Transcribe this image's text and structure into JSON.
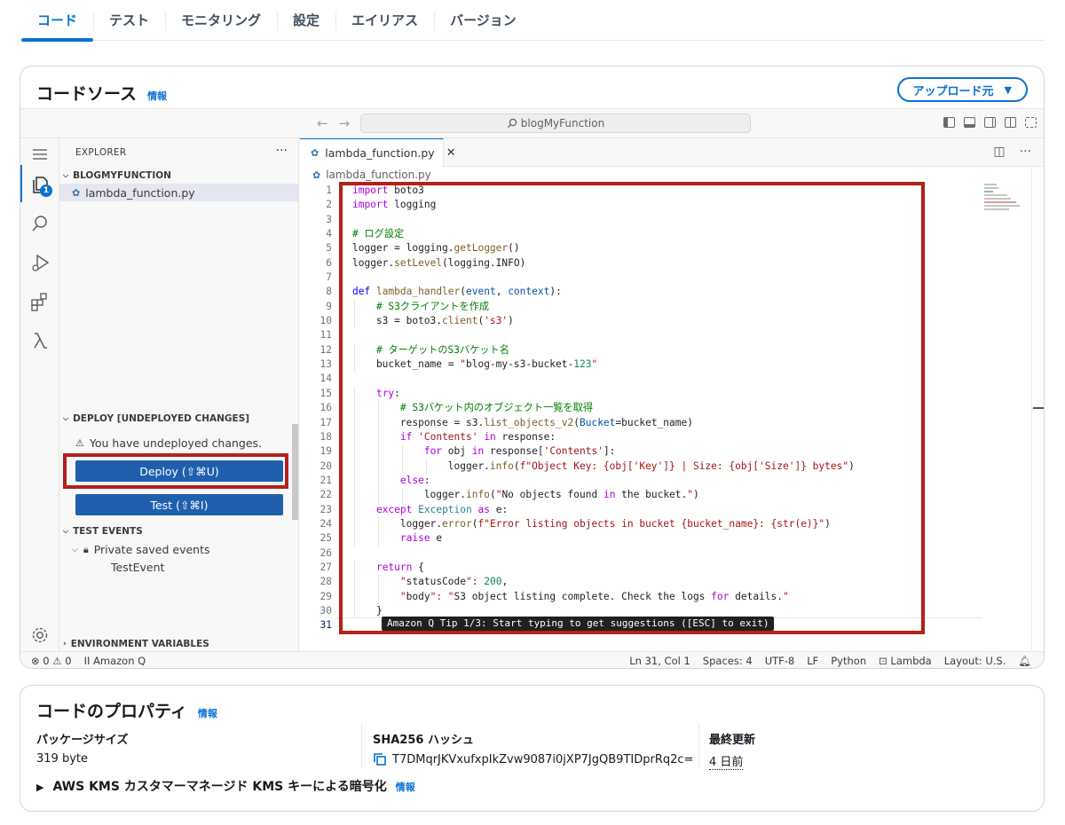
{
  "tabs": [
    "コード",
    "テスト",
    "モニタリング",
    "設定",
    "エイリアス",
    "バージョン"
  ],
  "code_source": {
    "title": "コードソース",
    "info": "情報",
    "upload_button": "アップロード元"
  },
  "ide": {
    "search_text": "blogMyFunction",
    "explorer_label": "EXPLORER",
    "folder_name": "BLOGMYFUNCTION",
    "file_name": "lambda_function.py",
    "explorer_badge": "1",
    "deploy_section": "DEPLOY [UNDEPLOYED CHANGES]",
    "undeployed_warning": "You have undeployed changes.",
    "deploy_button": "Deploy (⇧⌘U)",
    "test_button": "Test (⇧⌘I)",
    "test_events_section": "TEST EVENTS",
    "private_saved_events": "Private saved events",
    "test_event": "TestEvent",
    "env_vars_section": "ENVIRONMENT VARIABLES",
    "editor_tab": "lambda_function.py",
    "breadcrumb": "lambda_function.py",
    "tip": "Amazon Q Tip 1/3: Start typing to get suggestions ([ESC] to exit)",
    "code_lines": [
      "import boto3",
      "import logging",
      "",
      "# ログ設定",
      "logger = logging.getLogger()",
      "logger.setLevel(logging.INFO)",
      "",
      "def lambda_handler(event, context):",
      "    # S3クライアントを作成",
      "    s3 = boto3.client('s3')",
      "",
      "    # ターゲットのS3バケット名",
      "    bucket_name = \"blog-my-s3-bucket-123\"",
      "",
      "    try:",
      "        # S3バケット内のオブジェクト一覧を取得",
      "        response = s3.list_objects_v2(Bucket=bucket_name)",
      "        if 'Contents' in response:",
      "            for obj in response['Contents']:",
      "                logger.info(f\"Object Key: {obj['Key']} | Size: {obj['Size']} bytes\")",
      "        else:",
      "            logger.info(\"No objects found in the bucket.\")",
      "    except Exception as e:",
      "        logger.error(f\"Error listing objects in bucket {bucket_name}: {str(e)}\")",
      "        raise e",
      "",
      "    return {",
      "        \"statusCode\": 200,",
      "        \"body\": \"S3 object listing complete. Check the logs for details.\"",
      "    }",
      ""
    ],
    "status_bar": {
      "errors": "0",
      "warnings": "0",
      "amazon_q": "Amazon Q",
      "position": "Ln 31, Col 1",
      "spaces": "Spaces: 4",
      "encoding": "UTF-8",
      "eol": "LF",
      "language": "Python",
      "lambda": "Lambda",
      "layout": "Layout: U.S."
    }
  },
  "code_properties": {
    "title": "コードのプロパティ",
    "info": "情報",
    "package_size_label": "パッケージサイズ",
    "package_size_value": "319 byte",
    "sha_label": "SHA256 ハッシュ",
    "sha_value": "T7DMqrJKVxufxpIkZvw9087i0jXP7JgQB9TIDprRq2c=",
    "last_modified_label": "最終更新",
    "last_modified_value": "4 日前",
    "kms_label": "AWS KMS カスタマーマネージド KMS キーによる暗号化",
    "kms_info": "情報"
  },
  "colors": {
    "accent": "#0972d3",
    "deploy_button": "#1f5fad",
    "highlight_frame": "#b2211b"
  }
}
